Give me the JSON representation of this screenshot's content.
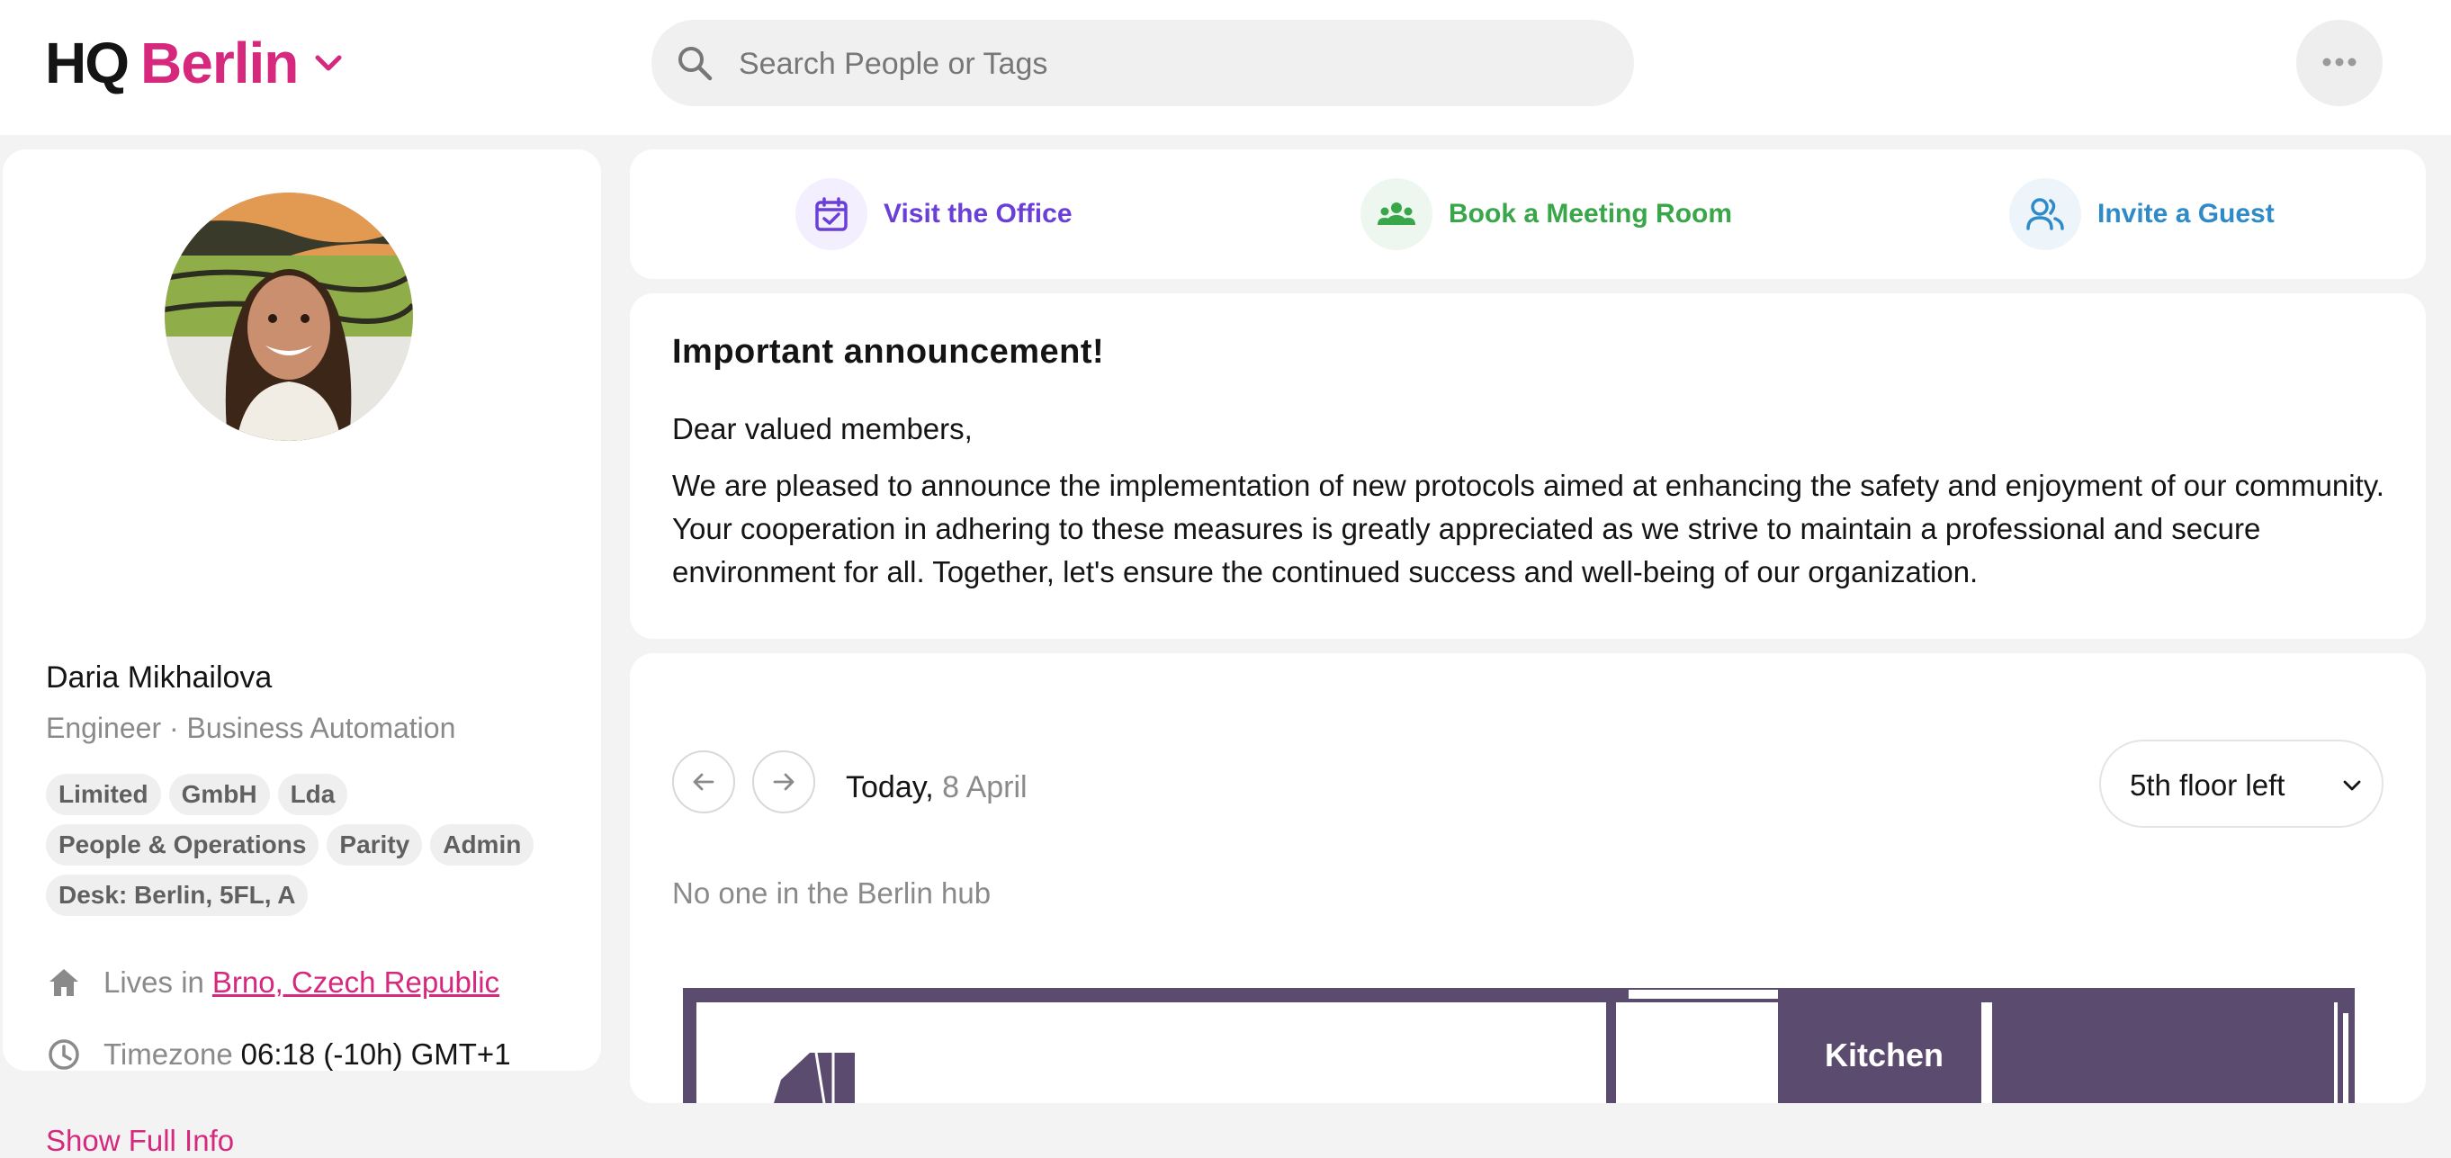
{
  "brand": {
    "prefix": "HQ",
    "city": "Berlin"
  },
  "search": {
    "placeholder": "Search People or Tags",
    "value": ""
  },
  "profile": {
    "name": "Daria Mikhailova",
    "role": "Engineer · Business Automation",
    "tags": [
      "Limited",
      "GmbH",
      "Lda",
      "People & Operations",
      "Parity",
      "Admin",
      "Desk: Berlin, 5FL, A"
    ],
    "lives_label": "Lives in",
    "lives_value": "Brno, Czech Republic",
    "timezone_label": "Timezone",
    "timezone_value": "06:18 (-10h) GMT+1",
    "show_full_info": "Show Full Info"
  },
  "actions": [
    {
      "label": "Visit the Office",
      "color": "#6a3fd8",
      "bg": "#f3efff",
      "icon": "calendar-check-icon"
    },
    {
      "label": "Book a Meeting Room",
      "color": "#3aa64a",
      "bg": "#eef7ef",
      "icon": "people-group-icon"
    },
    {
      "label": "Invite a Guest",
      "color": "#2f8ac8",
      "bg": "#edf5fb",
      "icon": "add-user-icon"
    }
  ],
  "announcement": {
    "title": "Important announcement!",
    "greeting": "Dear valued members,",
    "body": "We are pleased to announce the implementation of new protocols aimed at enhancing the safety and enjoyment of our community. Your cooperation in adhering to these measures is greatly appreciated as we strive to maintain a professional and secure environment for all. Together, let's ensure the continued success and well-being of our organization."
  },
  "schedule": {
    "today_label": "Today,",
    "date": "8 April",
    "floor": "5th floor left",
    "empty_message": "No one in the Berlin hub"
  },
  "floorplan": {
    "kitchen_label": "Kitchen",
    "wall_color": "#5b4b6e"
  },
  "colors": {
    "accent": "#d6297d",
    "background": "#f3f3f3"
  }
}
